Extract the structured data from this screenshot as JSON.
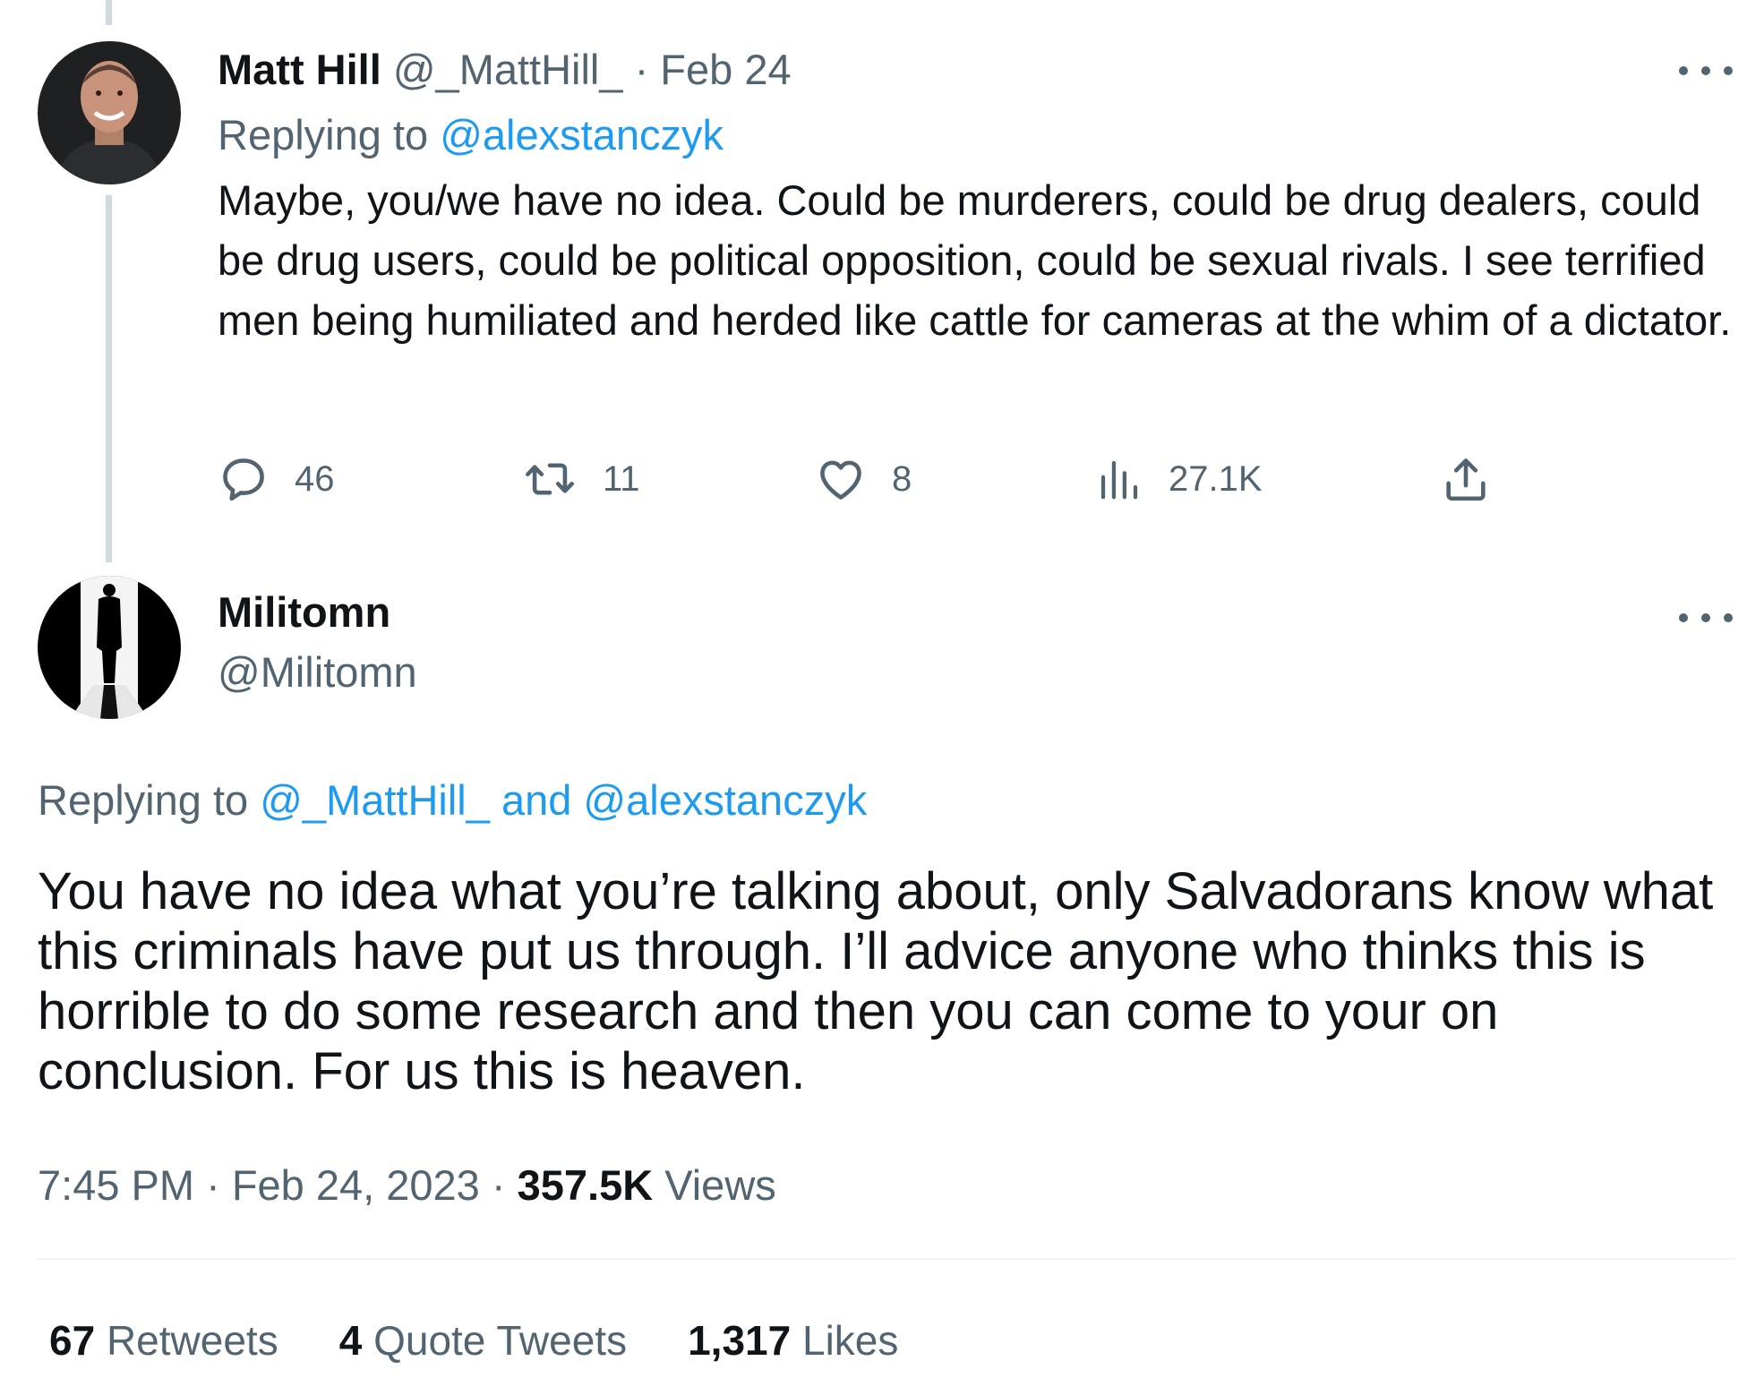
{
  "parent_tweet": {
    "display_name": "Matt Hill",
    "handle": "@_MattHill_",
    "date": "Feb 24",
    "separator": "·",
    "replying_label": "Replying to",
    "replying_to": "@alexstanczyk",
    "text": "Maybe, you/we have no idea. Could be murderers, could be drug dealers, could be drug users, could be political opposition, could be sexual rivals. I see terrified men being humiliated and herded like cattle for cameras at the whim of a dictator.",
    "actions": {
      "replies": "46",
      "retweets": "11",
      "likes": "8",
      "views": "27.1K"
    }
  },
  "main_tweet": {
    "display_name": "Militomn",
    "handle": "@Militomn",
    "replying_label": "Replying to",
    "replying_to_1": "@_MattHill_",
    "replying_and": "and",
    "replying_to_2": "@alexstanczyk",
    "text": "You have no idea what you’re talking about, only Salvadorans know what this criminals have put us through. I’ll advice anyone who thinks this is horrible to do some research and then you can come to your on conclusion. For us this is heaven.",
    "time": "7:45 PM",
    "date": "Feb 24, 2023",
    "separator": "·",
    "views_count": "357.5K",
    "views_label": "Views",
    "stats": {
      "retweets_count": "67",
      "retweets_label": "Retweets",
      "quotes_count": "4",
      "quotes_label": "Quote Tweets",
      "likes_count": "1,317",
      "likes_label": "Likes"
    }
  },
  "icons": {
    "reply": "reply-icon",
    "retweet": "retweet-icon",
    "like": "heart-icon",
    "views": "analytics-icon",
    "share": "share-icon",
    "more": "more-icon"
  },
  "colors": {
    "link": "#1d9bf0",
    "secondary_text": "#536471",
    "primary_text": "#0f1419",
    "thread_line": "#cfd9de"
  }
}
